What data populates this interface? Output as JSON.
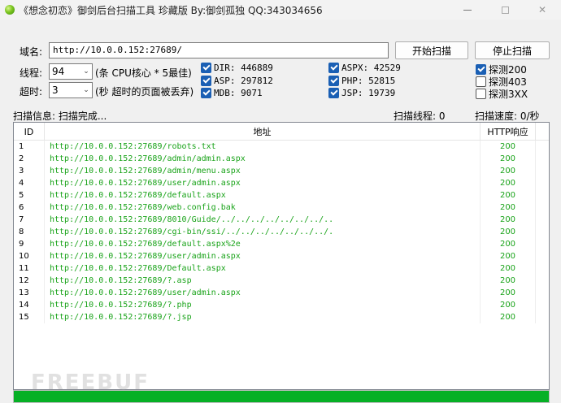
{
  "window": {
    "title": "《想念初恋》御剑后台扫描工具 珍藏版 By:御剑孤独 QQ:343034656"
  },
  "form": {
    "domain_label": "域名:",
    "domain_value": "http://10.0.0.152:27689/",
    "threads_label": "线程:",
    "threads_value": "94",
    "threads_hint": "(条 CPU核心 * 5最佳)",
    "timeout_label": "超时:",
    "timeout_value": "3",
    "timeout_hint": "(秒 超时的页面被丢弃)",
    "start_button": "开始扫描",
    "stop_button": "停止扫描"
  },
  "dicts": [
    {
      "label": "DIR: 446889",
      "checked": true
    },
    {
      "label": "ASP: 297812",
      "checked": true
    },
    {
      "label": "MDB: 9071",
      "checked": true
    },
    {
      "label": "ASPX: 42529",
      "checked": true
    },
    {
      "label": "PHP: 52815",
      "checked": true
    },
    {
      "label": "JSP: 19739",
      "checked": true
    }
  ],
  "probes": [
    {
      "label": "探测200",
      "checked": true
    },
    {
      "label": "探测403",
      "checked": false
    },
    {
      "label": "探测3XX",
      "checked": false
    }
  ],
  "status": {
    "info": "扫描信息: 扫描完成...",
    "threads": "扫描线程: 0",
    "speed": "扫描速度: 0/秒"
  },
  "table": {
    "headers": [
      "ID",
      "地址",
      "HTTP响应"
    ],
    "rows": [
      [
        "1",
        "http://10.0.0.152:27689/robots.txt",
        "200"
      ],
      [
        "2",
        "http://10.0.0.152:27689/admin/admin.aspx",
        "200"
      ],
      [
        "3",
        "http://10.0.0.152:27689/admin/menu.aspx",
        "200"
      ],
      [
        "4",
        "http://10.0.0.152:27689/user/admin.aspx",
        "200"
      ],
      [
        "5",
        "http://10.0.0.152:27689/default.aspx",
        "200"
      ],
      [
        "6",
        "http://10.0.0.152:27689/web.config.bak",
        "200"
      ],
      [
        "7",
        "http://10.0.0.152:27689/8010/Guide/../../../../../../../..",
        "200"
      ],
      [
        "8",
        "http://10.0.0.152:27689/cgi-bin/ssi/../../../../../../../.",
        "200"
      ],
      [
        "9",
        "http://10.0.0.152:27689/default.aspx%2e",
        "200"
      ],
      [
        "10",
        "http://10.0.0.152:27689/user/admin.aspx",
        "200"
      ],
      [
        "11",
        "http://10.0.0.152:27689/Default.aspx",
        "200"
      ],
      [
        "12",
        "http://10.0.0.152:27689/?.asp",
        "200"
      ],
      [
        "13",
        "http://10.0.0.152:27689/user/admin.aspx",
        "200"
      ],
      [
        "14",
        "http://10.0.0.152:27689/?.php",
        "200"
      ],
      [
        "15",
        "http://10.0.0.152:27689/?.jsp",
        "200"
      ]
    ]
  },
  "progress_fraction": 1.0,
  "colors": {
    "ok_text": "#19a319",
    "progress": "#06b025",
    "checkbox": "#1a5fb4"
  }
}
